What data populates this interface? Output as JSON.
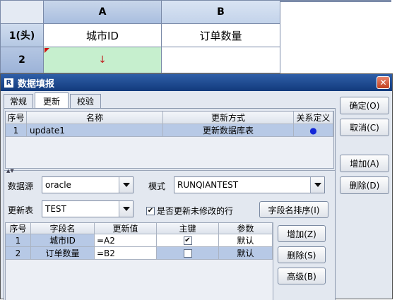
{
  "sheet": {
    "col_headers": [
      "A",
      "B"
    ],
    "row_headers": [
      "1(头)",
      "2"
    ],
    "cells": {
      "A1": "城市ID",
      "B1": "订单数量"
    },
    "arrow": "↓"
  },
  "dialog": {
    "title": "数据填报",
    "title_icon": "R",
    "close": "✕",
    "tabs": [
      "常规",
      "更新",
      "校验"
    ],
    "buttons": {
      "ok": "确定(O)",
      "cancel": "取消(C)",
      "add": "增加(A)",
      "delete": "删除(D)"
    },
    "update_table": {
      "headers": [
        "序号",
        "名称",
        "更新方式",
        "关系定义"
      ],
      "rows": [
        {
          "no": "1",
          "name": "update1",
          "mode": "更新数据库表",
          "rel": "●"
        }
      ]
    },
    "form": {
      "datasource_label": "数据源",
      "datasource_value": "oracle",
      "schema_label": "模式",
      "schema_value": "RUNQIANTEST",
      "table_label": "更新表",
      "table_value": "TEST",
      "update_unmodified_label": "是否更新未修改的行",
      "sort_fields_button": "字段名排序(I)"
    },
    "field_table": {
      "headers": [
        "序号",
        "字段名",
        "更新值",
        "主键",
        "参数"
      ],
      "rows": [
        {
          "no": "1",
          "field": "城市ID",
          "value": "=A2",
          "key": true,
          "param": "默认"
        },
        {
          "no": "2",
          "field": "订单数量",
          "value": "=B2",
          "key": false,
          "param": "默认"
        }
      ]
    },
    "field_buttons": {
      "add": "增加(Z)",
      "delete": "删除(S)",
      "advanced": "高级(B)"
    }
  }
}
